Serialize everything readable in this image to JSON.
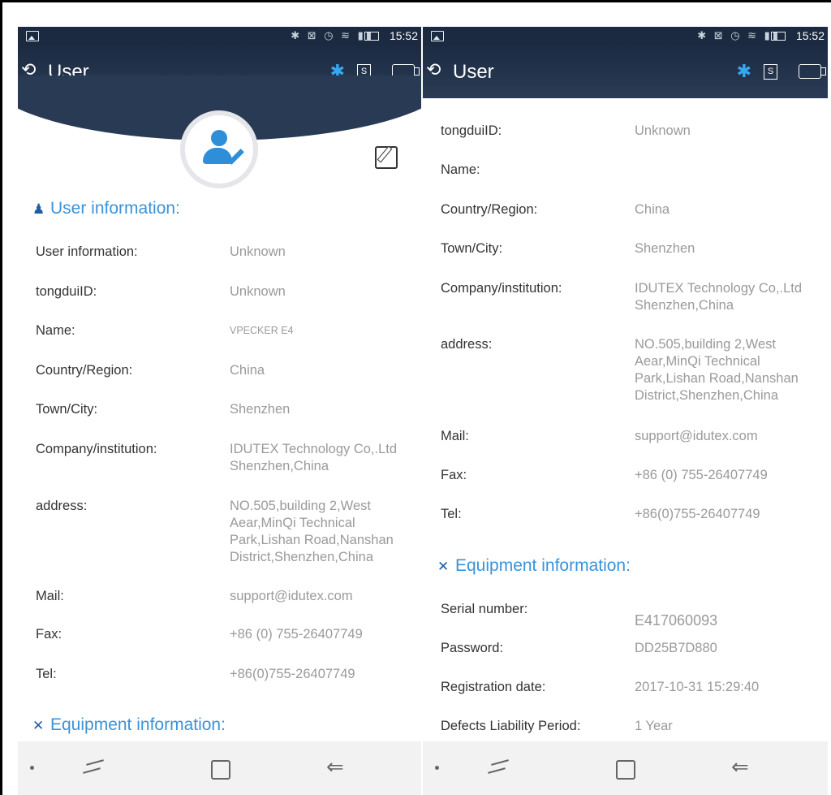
{
  "statusbar": {
    "time": "15:52"
  },
  "appbar": {
    "title": "User"
  },
  "sections": {
    "user_info": "User information:",
    "equipment_info": "Equipment information:"
  },
  "user_fields": [
    {
      "label": "User information:",
      "value": "Unknown"
    },
    {
      "label": "tongduiID:",
      "value": "Unknown"
    },
    {
      "label": "Name:",
      "value": "VPECKER E4"
    },
    {
      "label": "Country/Region:",
      "value": "China"
    },
    {
      "label": "Town/City:",
      "value": "Shenzhen"
    },
    {
      "label": "Company/institution:",
      "value_lines": [
        "IDUTEX Technology Co,.Ltd",
        "Shenzhen,China"
      ]
    },
    {
      "label": "address:",
      "value_lines": [
        "NO.505,building 2,West",
        "Aear,MinQi Technical",
        "Park,Lishan Road,Nanshan",
        "District,Shenzhen,China"
      ]
    },
    {
      "label": "Mail:",
      "value": "support@idutex.com"
    },
    {
      "label": "Fax:",
      "value": "+86 (0) 755-26407749"
    },
    {
      "label": "Tel:",
      "value": "+86(0)755-26407749"
    }
  ],
  "right_user_fields": [
    {
      "label": "tongduiID:",
      "value": "Unknown"
    },
    {
      "label": "Name:",
      "value": ""
    },
    {
      "label": "Country/Region:",
      "value": "China"
    },
    {
      "label": "Town/City:",
      "value": "Shenzhen"
    }
  ],
  "equipment_fields": [
    {
      "label": "Serial number:",
      "value": "E417060093"
    },
    {
      "label": "Password:",
      "value": "DD25B7D880"
    },
    {
      "label": "Registration date:",
      "value": "2017-10-31 15:29:40"
    },
    {
      "label": "Defects Liability Period:",
      "value": "1 Year"
    }
  ],
  "colors": {
    "accent": "#3a93d9",
    "header_bg": "#1c2b42",
    "bluetooth": "#35a8f0"
  }
}
